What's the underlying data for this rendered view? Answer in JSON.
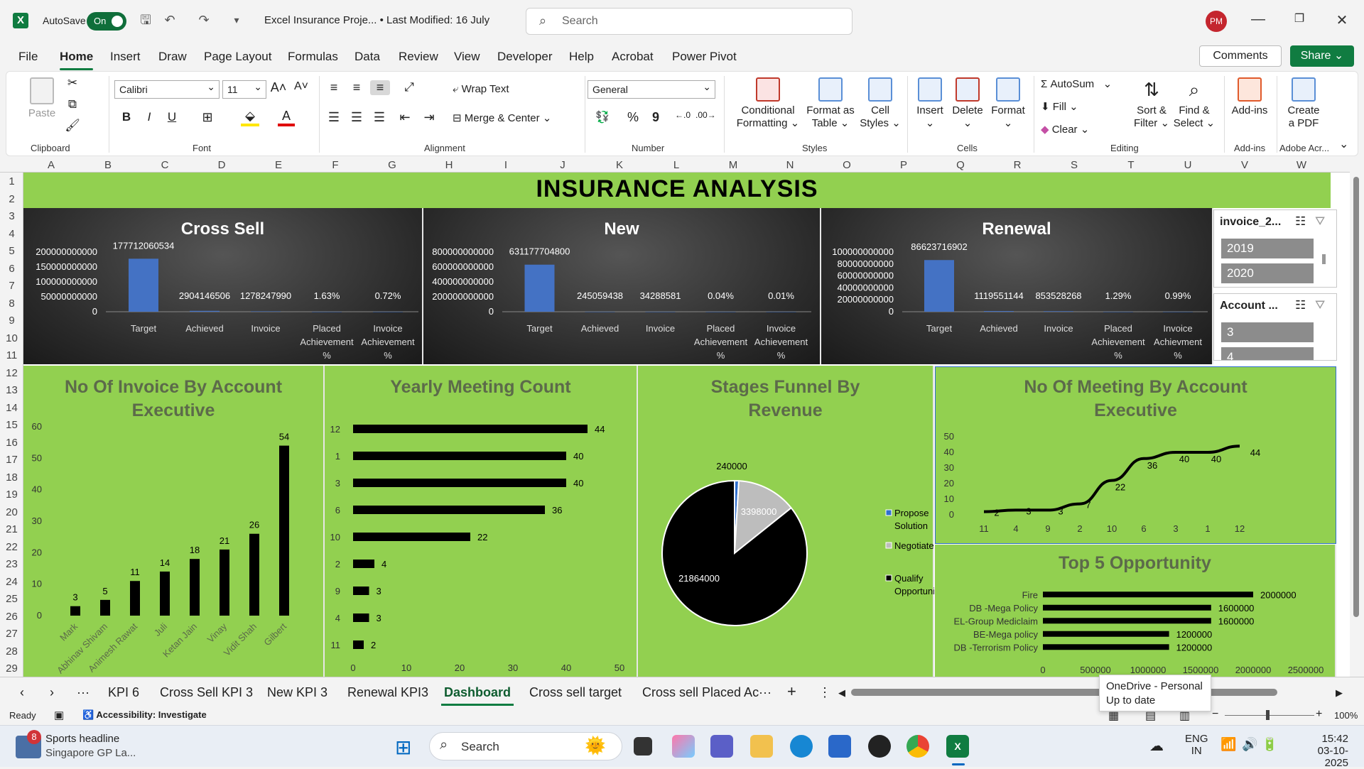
{
  "app": {
    "autosave_label": "AutoSave",
    "autosave_state": "On",
    "doc_title": "Excel Insurance Proje... • Last Modified: 16 July",
    "search_placeholder": "Search",
    "user_initials": "PM"
  },
  "menu": [
    "File",
    "Home",
    "Insert",
    "Draw",
    "Page Layout",
    "Formulas",
    "Data",
    "Review",
    "View",
    "Developer",
    "Help",
    "Acrobat",
    "Power Pivot"
  ],
  "menu_right": {
    "comments": "Comments",
    "share": "Share"
  },
  "ribbon": {
    "clipboard": {
      "label": "Clipboard",
      "paste": "Paste"
    },
    "font": {
      "label": "Font",
      "name": "Calibri",
      "size": "11"
    },
    "alignment": {
      "label": "Alignment",
      "wrap": "Wrap Text",
      "merge": "Merge & Center"
    },
    "number": {
      "label": "Number",
      "format": "General"
    },
    "styles": {
      "label": "Styles",
      "cond_1": "Conditional",
      "cond_2": "Formatting",
      "fmt_table_1": "Format as",
      "fmt_table_2": "Table",
      "cell_styles_1": "Cell",
      "cell_styles_2": "Styles"
    },
    "cells": {
      "label": "Cells",
      "insert": "Insert",
      "delete": "Delete",
      "format": "Format"
    },
    "editing": {
      "label": "Editing",
      "autosum": "AutoSum",
      "fill": "Fill",
      "clear": "Clear",
      "sort_1": "Sort &",
      "sort_2": "Filter",
      "find_1": "Find &",
      "find_2": "Select"
    },
    "addins": {
      "label": "Add-ins",
      "btn": "Add-ins"
    },
    "adobe": {
      "label": "Adobe Acr...",
      "btn_1": "Create",
      "btn_2": "a PDF"
    }
  },
  "columns": [
    "A",
    "B",
    "C",
    "D",
    "E",
    "F",
    "G",
    "H",
    "I",
    "J",
    "K",
    "L",
    "M",
    "N",
    "O",
    "P",
    "Q",
    "R",
    "S",
    "T",
    "U",
    "V",
    "W"
  ],
  "rows": [
    "1",
    "2",
    "3",
    "4",
    "5",
    "6",
    "7",
    "8",
    "9",
    "10",
    "11",
    "12",
    "13",
    "14",
    "15",
    "16",
    "17",
    "18",
    "19",
    "20",
    "21",
    "22",
    "23",
    "24",
    "25",
    "26",
    "27",
    "28",
    "29"
  ],
  "dashboard": {
    "title": "INSURANCE ANALYSIS",
    "slicers": [
      {
        "header": "invoice_2...",
        "items": [
          "2019",
          "2020"
        ]
      },
      {
        "header": "Account ...",
        "items": [
          "3",
          "4"
        ]
      }
    ]
  },
  "chart_data": [
    {
      "type": "bar",
      "title": "Cross Sell",
      "categories": [
        "Target",
        "Achieved",
        "Invoice",
        "Placed Achievement %",
        "Invoice Achievement %"
      ],
      "values": [
        177712060534,
        2904146506,
        1278247990,
        0,
        0
      ],
      "data_labels": [
        "177712060534",
        "2904146506",
        "1278247990",
        "1.63%",
        "0.72%"
      ],
      "y_ticks": [
        "200000000000",
        "150000000000",
        "100000000000",
        "50000000000",
        "0"
      ],
      "ylim": [
        0,
        200000000000
      ]
    },
    {
      "type": "bar",
      "title": "New",
      "categories": [
        "Target",
        "Achieved",
        "Invoice",
        "Placed Achievement %",
        "Invoice Achievement %"
      ],
      "values": [
        631177704800,
        245059438,
        34288581,
        0,
        0
      ],
      "data_labels": [
        "631177704800",
        "245059438",
        "34288581",
        "0.04%",
        "0.01%"
      ],
      "y_ticks": [
        "800000000000",
        "600000000000",
        "400000000000",
        "200000000000",
        "0"
      ],
      "ylim": [
        0,
        800000000000
      ]
    },
    {
      "type": "bar",
      "title": "Renewal",
      "categories": [
        "Target",
        "Achieved",
        "Invoice",
        "Placed Achievement %",
        "Invoice Achievment %"
      ],
      "values": [
        86623716902,
        1119551144,
        853528268,
        0,
        0
      ],
      "data_labels": [
        "86623716902",
        "1119551144",
        "853528268",
        "1.29%",
        "0.99%"
      ],
      "y_ticks": [
        "100000000000",
        "80000000000",
        "60000000000",
        "40000000000",
        "20000000000",
        "0"
      ],
      "ylim": [
        0,
        100000000000
      ]
    },
    {
      "type": "bar",
      "title": "No Of Invoice By Account Executive",
      "categories": [
        "Mark",
        "Abhinav Shivam",
        "Animesh Rawat",
        "Juli",
        "Ketan Jain",
        "Vinay",
        "Vidit Shah",
        "Gilbert"
      ],
      "values": [
        3,
        5,
        11,
        14,
        18,
        21,
        26,
        54
      ],
      "y_ticks": [
        "0",
        "10",
        "20",
        "30",
        "40",
        "50",
        "60"
      ],
      "ylim": [
        0,
        60
      ]
    },
    {
      "type": "bar",
      "title": "Yearly Meeting Count",
      "orientation": "horizontal",
      "categories": [
        "12",
        "1",
        "3",
        "6",
        "10",
        "2",
        "9",
        "4",
        "11"
      ],
      "values": [
        44,
        40,
        40,
        36,
        22,
        4,
        3,
        3,
        2
      ],
      "x_ticks": [
        "0",
        "10",
        "20",
        "30",
        "40",
        "50"
      ],
      "xlim": [
        0,
        50
      ]
    },
    {
      "type": "pie",
      "title": "Stages Funnel By Revenue",
      "categories": [
        "Propose Solution",
        "Negotiate",
        "Qualify Opportunity"
      ],
      "values": [
        240000,
        3398000,
        21864000
      ],
      "colors": [
        "#2f6fcf",
        "#bdbdbd",
        "#000000"
      ]
    },
    {
      "type": "line",
      "title": "No Of Meeting By Account Executive",
      "categories": [
        "11",
        "4",
        "9",
        "2",
        "10",
        "6",
        "3",
        "1",
        "12"
      ],
      "values": [
        2,
        3,
        3,
        7,
        22,
        36,
        40,
        40,
        44
      ],
      "y_ticks": [
        "0",
        "10",
        "20",
        "30",
        "40",
        "50"
      ],
      "ylim": [
        0,
        50
      ]
    },
    {
      "type": "bar",
      "title": "Top 5 Opportunity",
      "orientation": "horizontal",
      "categories": [
        "Fire",
        "DB -Mega Policy",
        "EL-Group Mediclaim",
        "BE-Mega policy",
        "DB -Terrorism Policy"
      ],
      "values": [
        2000000,
        1600000,
        1600000,
        1200000,
        1200000
      ],
      "x_ticks": [
        "0",
        "500000",
        "1000000",
        "1500000",
        "2000000",
        "2500000"
      ],
      "xlim": [
        0,
        2500000
      ]
    }
  ],
  "tabs": [
    "KPI 6",
    "Cross Sell KPI 3",
    "New KPI 3",
    "Renewal KPI3",
    "Dashboard",
    "Cross sell target",
    "Cross sell Placed Ac"
  ],
  "active_tab": "Dashboard",
  "status": {
    "ready": "Ready",
    "accessibility": "Accessibility: Investigate",
    "zoom": "100%"
  },
  "onedrive": {
    "line1": "OneDrive - Personal",
    "line2": "Up to date"
  },
  "taskbar": {
    "news_badge": "8",
    "news_title": "Sports headline",
    "news_sub": "Singapore GP La...",
    "search": "Search",
    "lang1": "ENG",
    "lang2": "IN",
    "time": "15:42",
    "date": "03-10-2025"
  }
}
